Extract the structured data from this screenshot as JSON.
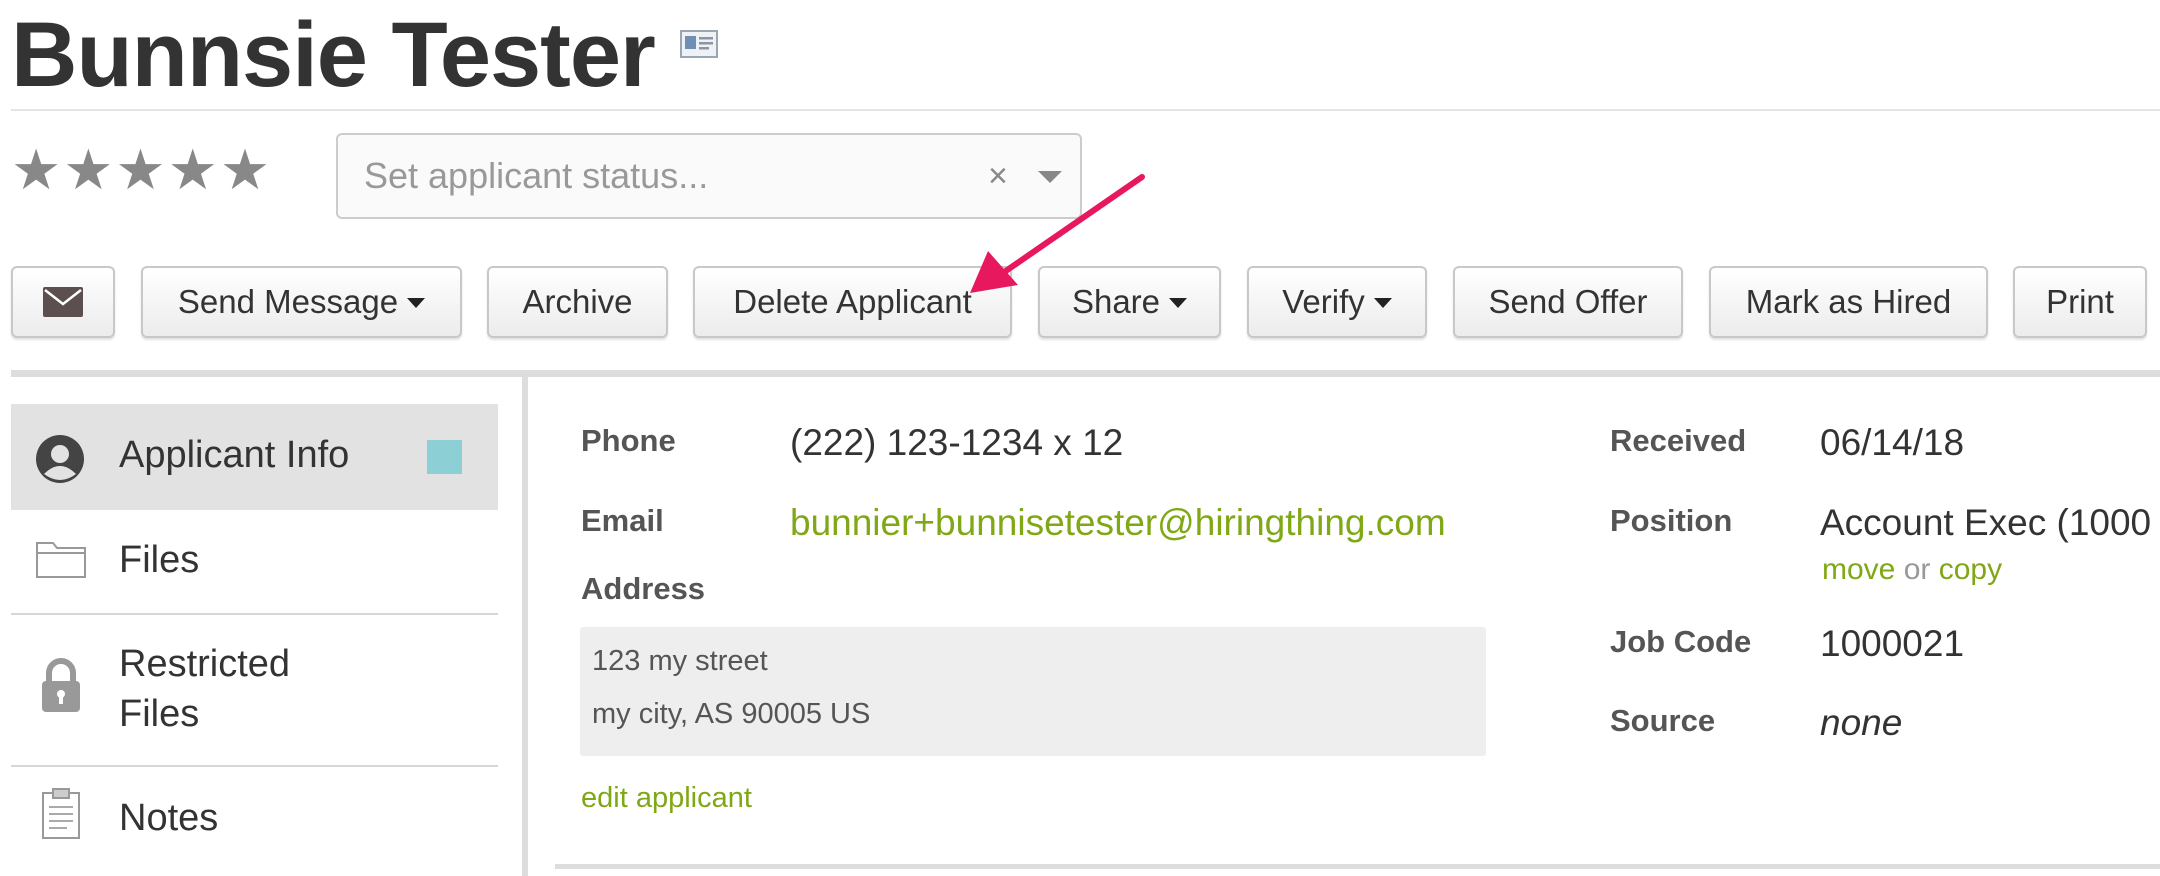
{
  "applicant": {
    "name": "Bunnsie Tester"
  },
  "rating": {
    "stars": [
      "★",
      "★",
      "★",
      "★",
      "★"
    ],
    "value": 0
  },
  "status_select": {
    "placeholder": "Set applicant status...",
    "clear_glyph": "×"
  },
  "toolbar": {
    "email_icon": "envelope-icon",
    "send_message": "Send Message",
    "archive": "Archive",
    "delete_applicant": "Delete Applicant",
    "share": "Share",
    "verify": "Verify",
    "send_offer": "Send Offer",
    "mark_as_hired": "Mark as Hired",
    "print": "Print"
  },
  "sidebar": {
    "items": [
      {
        "label": "Applicant Info",
        "icon": "user-circle-icon",
        "active": true
      },
      {
        "label": "Files",
        "icon": "folder-icon"
      },
      {
        "label_line1": "Restricted",
        "label_line2": "Files",
        "icon": "lock-icon"
      },
      {
        "label": "Notes",
        "icon": "clipboard-icon"
      }
    ],
    "active_swatch_color": "#8ccfd4"
  },
  "details": {
    "phone_label": "Phone",
    "phone": "(222) 123-1234 x 12",
    "email_label": "Email",
    "email": "bunnier+bunnisetester@hiringthing.com",
    "address_label": "Address",
    "address_line1": "123 my street",
    "address_line2": "my city, AS 90005 US",
    "edit_link": "edit applicant"
  },
  "job": {
    "received_label": "Received",
    "received": "06/14/18",
    "position_label": "Position",
    "position": "Account Exec (1000",
    "move_link": "move",
    "or_text": "or",
    "copy_link": "copy",
    "job_code_label": "Job Code",
    "job_code": "1000021",
    "source_label": "Source",
    "source": "none"
  },
  "colors": {
    "link_green": "#80a816",
    "annotation_pink": "#e8185e"
  }
}
